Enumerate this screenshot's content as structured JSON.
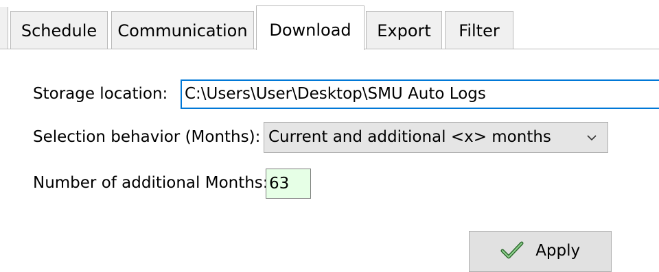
{
  "tabs": [
    {
      "label": "Schedule",
      "active": false
    },
    {
      "label": "Communication",
      "active": false
    },
    {
      "label": "Download",
      "active": true
    },
    {
      "label": "Export",
      "active": false
    },
    {
      "label": "Filter",
      "active": false
    }
  ],
  "form": {
    "storage_label": "Storage location:",
    "storage_value": "C:\\Users\\User\\Desktop\\SMU Auto Logs",
    "selection_label": "Selection behavior (Months):",
    "selection_value": "Current and additional <x> months",
    "months_label": "Number of additional Months:",
    "months_value": "63"
  },
  "actions": {
    "apply_label": "Apply"
  },
  "icons": {
    "apply": "check-icon",
    "dropdown": "chevron-down-icon"
  },
  "colors": {
    "focus_border": "#0078d7",
    "months_field_bg": "#e6ffe6",
    "check": "#3f8f3f"
  }
}
